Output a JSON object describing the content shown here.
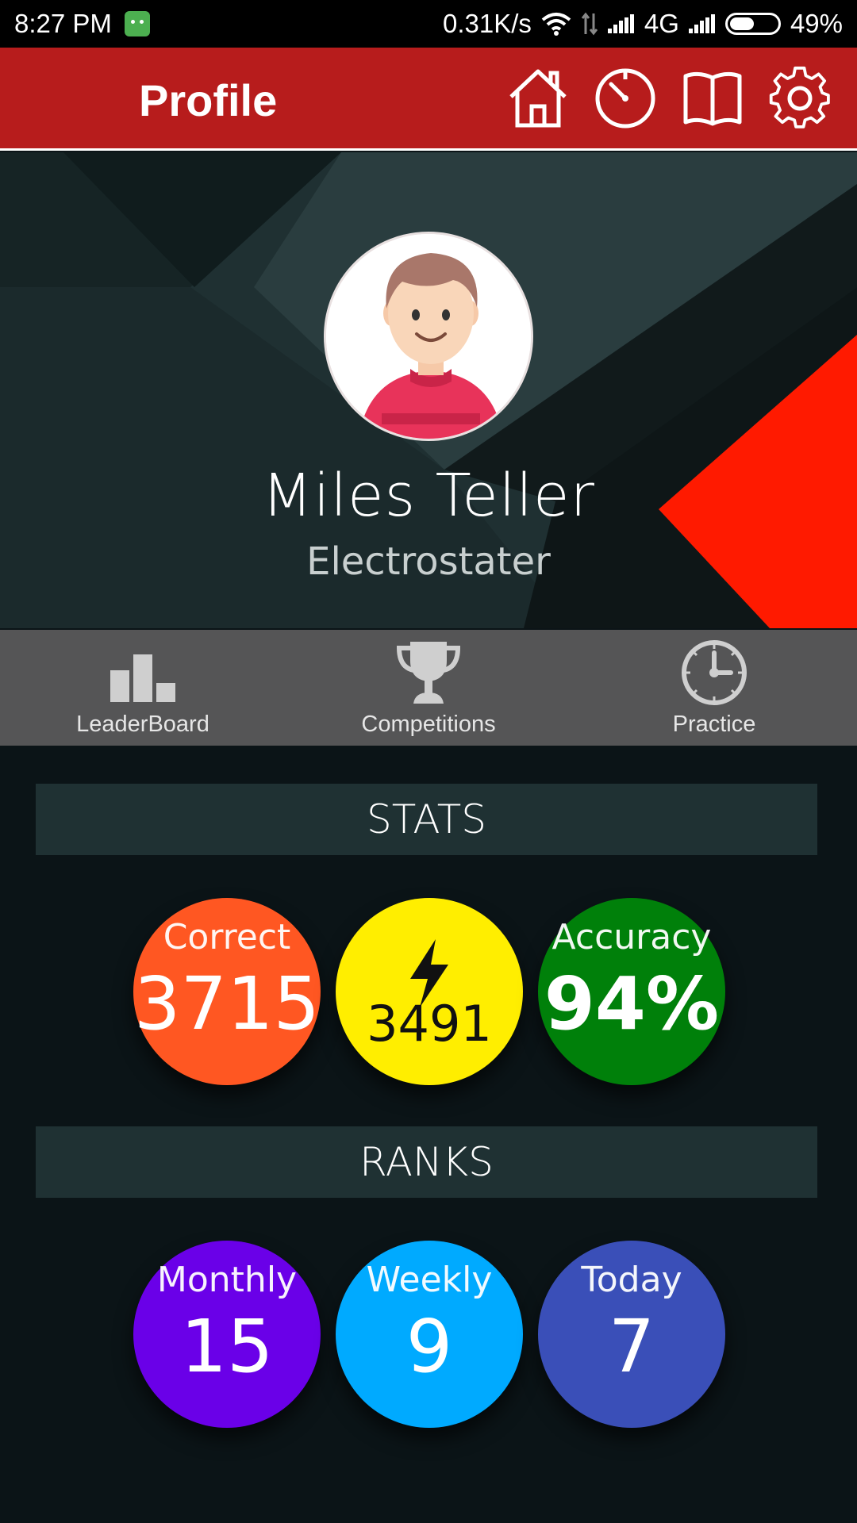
{
  "status_bar": {
    "time": "8:27 PM",
    "speed": "0.31K/s",
    "network": "4G",
    "battery": "49%"
  },
  "app_bar": {
    "title": "Profile",
    "icons": [
      "home-icon",
      "timer-icon",
      "book-icon",
      "settings-icon"
    ]
  },
  "profile": {
    "name": "Miles Teller",
    "role": "Electrostater"
  },
  "quick_nav": [
    {
      "label": "LeaderBoard",
      "icon": "leaderboard-icon"
    },
    {
      "label": "Competitions",
      "icon": "trophy-icon"
    },
    {
      "label": "Practice",
      "icon": "clock-icon"
    }
  ],
  "stats": {
    "title": "STATS",
    "items": [
      {
        "label": "Correct",
        "value": "3715",
        "color": "#ff5722"
      },
      {
        "label": "",
        "value": "3491",
        "color": "#ffee00",
        "icon": "lightning-icon"
      },
      {
        "label": "Accuracy",
        "value": "94%",
        "color": "#00800a"
      }
    ]
  },
  "ranks": {
    "title": "RANKS",
    "items": [
      {
        "label": "Monthly",
        "value": "15",
        "color": "#6a00e8"
      },
      {
        "label": "Weekly",
        "value": "9",
        "color": "#00aaff"
      },
      {
        "label": "Today",
        "value": "7",
        "color": "#3a4fb8"
      }
    ]
  },
  "colors": {
    "app_bar": "#b71c1c",
    "accent_triangle": "#ff1a00",
    "nav_bg": "#555556",
    "section_bar": "#1f3133"
  }
}
